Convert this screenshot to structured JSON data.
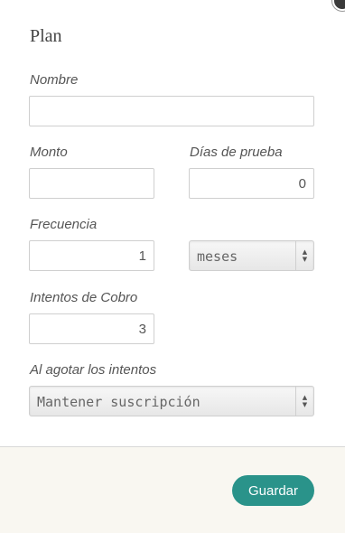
{
  "title": "Plan",
  "fields": {
    "nombre": {
      "label": "Nombre",
      "value": ""
    },
    "monto": {
      "label": "Monto",
      "value": ""
    },
    "dias_prueba": {
      "label": "Días de prueba",
      "value": "0"
    },
    "frecuencia": {
      "label": "Frecuencia",
      "value": "1",
      "unit": "meses"
    },
    "intentos": {
      "label": "Intentos de Cobro",
      "value": "3"
    },
    "al_agotar": {
      "label": "Al agotar los intentos",
      "value": "Mantener suscripción"
    }
  },
  "icons": {
    "select_arrows": "updown-arrows-icon",
    "close": "close-icon"
  },
  "footer": {
    "save_label": "Guardar"
  },
  "colors": {
    "accent": "#2a938a",
    "footer_bg": "#f9f7f1"
  }
}
